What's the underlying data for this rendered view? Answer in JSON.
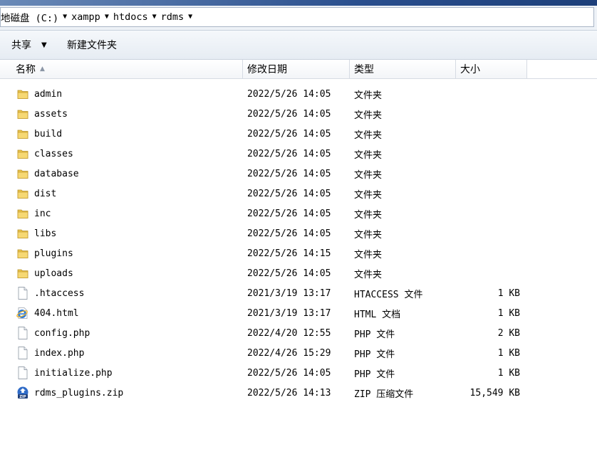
{
  "address": {
    "crumbs": [
      "地磁盘 (C:)",
      "xampp",
      "htdocs",
      "rdms"
    ]
  },
  "toolbar": {
    "share_label": "共享",
    "new_folder_label": "新建文件夹"
  },
  "columns": {
    "name": "名称",
    "date": "修改日期",
    "type": "类型",
    "size": "大小"
  },
  "files": [
    {
      "icon": "folder-icon",
      "name": "admin",
      "date": "2022/5/26 14:05",
      "type": "文件夹",
      "size": ""
    },
    {
      "icon": "folder-icon",
      "name": "assets",
      "date": "2022/5/26 14:05",
      "type": "文件夹",
      "size": ""
    },
    {
      "icon": "folder-icon",
      "name": "build",
      "date": "2022/5/26 14:05",
      "type": "文件夹",
      "size": ""
    },
    {
      "icon": "folder-icon",
      "name": "classes",
      "date": "2022/5/26 14:05",
      "type": "文件夹",
      "size": ""
    },
    {
      "icon": "folder-icon",
      "name": "database",
      "date": "2022/5/26 14:05",
      "type": "文件夹",
      "size": ""
    },
    {
      "icon": "folder-icon",
      "name": "dist",
      "date": "2022/5/26 14:05",
      "type": "文件夹",
      "size": ""
    },
    {
      "icon": "folder-icon",
      "name": "inc",
      "date": "2022/5/26 14:05",
      "type": "文件夹",
      "size": ""
    },
    {
      "icon": "folder-icon",
      "name": "libs",
      "date": "2022/5/26 14:05",
      "type": "文件夹",
      "size": ""
    },
    {
      "icon": "folder-icon",
      "name": "plugins",
      "date": "2022/5/26 14:15",
      "type": "文件夹",
      "size": ""
    },
    {
      "icon": "folder-icon",
      "name": "uploads",
      "date": "2022/5/26 14:05",
      "type": "文件夹",
      "size": ""
    },
    {
      "icon": "file-icon",
      "name": ".htaccess",
      "date": "2021/3/19 13:17",
      "type": "HTACCESS 文件",
      "size": "1 KB"
    },
    {
      "icon": "ie-html-icon",
      "name": "404.html",
      "date": "2021/3/19 13:17",
      "type": "HTML 文档",
      "size": "1 KB"
    },
    {
      "icon": "file-icon",
      "name": "config.php",
      "date": "2022/4/20 12:55",
      "type": "PHP 文件",
      "size": "2 KB"
    },
    {
      "icon": "file-icon",
      "name": "index.php",
      "date": "2022/4/26 15:29",
      "type": "PHP 文件",
      "size": "1 KB"
    },
    {
      "icon": "file-icon",
      "name": "initialize.php",
      "date": "2022/5/26 14:05",
      "type": "PHP 文件",
      "size": "1 KB"
    },
    {
      "icon": "zip-icon",
      "name": "rdms_plugins.zip",
      "date": "2022/5/26 14:13",
      "type": "ZIP 压缩文件",
      "size": "15,549 KB"
    }
  ]
}
